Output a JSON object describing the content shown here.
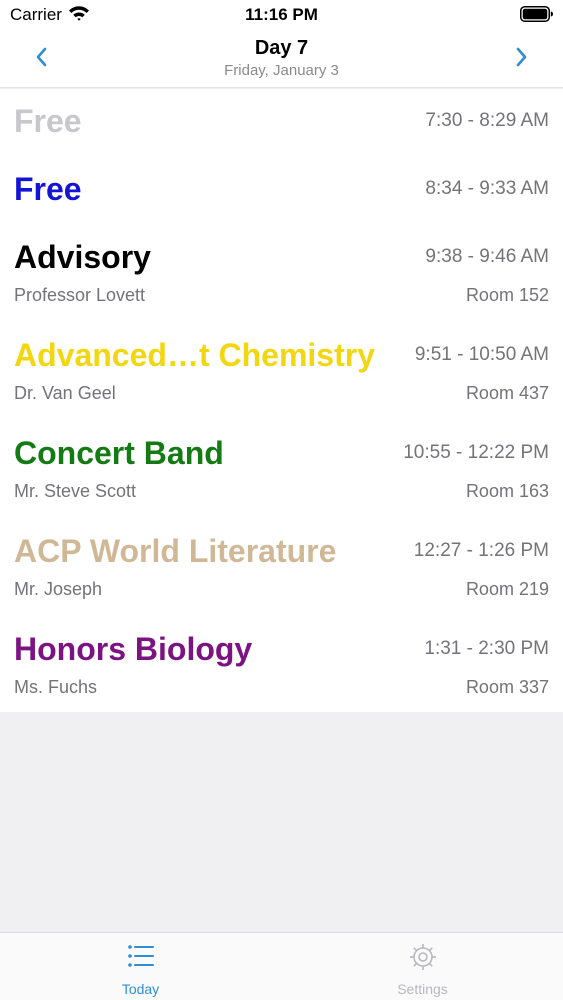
{
  "status": {
    "carrier": "Carrier",
    "time": "11:16 PM"
  },
  "nav": {
    "title": "Day 7",
    "subtitle": "Friday, January 3",
    "accent_color": "#2f8ed8"
  },
  "periods": [
    {
      "name": "Free",
      "time": "7:30 - 8:29 AM",
      "teacher": "",
      "room": "",
      "color": "#c7c7cc"
    },
    {
      "name": "Free",
      "time": "8:34 - 9:33 AM",
      "teacher": "",
      "room": "",
      "color": "#1414d6"
    },
    {
      "name": "Advisory",
      "time": "9:38 - 9:46 AM",
      "teacher": "Professor Lovett",
      "room": "Room 152",
      "color": "#000000"
    },
    {
      "name": "Advanced…t Chemistry",
      "time": "9:51 - 10:50 AM",
      "teacher": "Dr. Van Geel",
      "room": "Room 437",
      "color": "#f2d60f"
    },
    {
      "name": "Concert Band",
      "time": "10:55 - 12:22 PM",
      "teacher": "Mr. Steve Scott",
      "room": "Room 163",
      "color": "#147a14"
    },
    {
      "name": "ACP World Literature",
      "time": "12:27 - 1:26 PM",
      "teacher": "Mr. Joseph",
      "room": "Room 219",
      "color": "#d0b896"
    },
    {
      "name": "Honors Biology",
      "time": "1:31 - 2:30 PM",
      "teacher": "Ms. Fuchs",
      "room": "Room 337",
      "color": "#7d1283"
    }
  ],
  "tabs": [
    {
      "label": "Today",
      "icon": "list-icon",
      "active": true
    },
    {
      "label": "Settings",
      "icon": "gear-icon",
      "active": false
    }
  ],
  "colors": {
    "active_tab": "#2f8ed8",
    "inactive_tab": "#b8b8bd"
  }
}
